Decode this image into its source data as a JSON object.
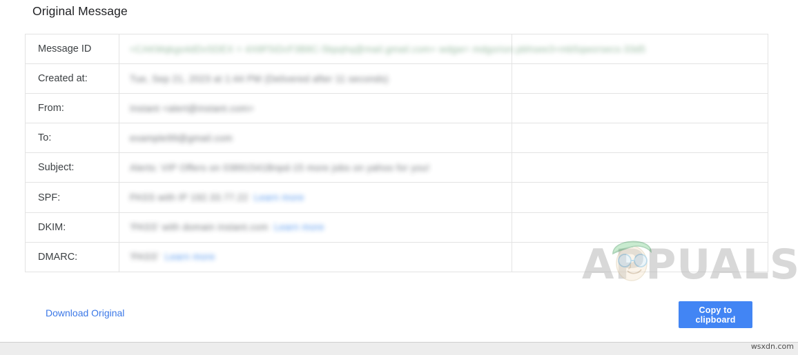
{
  "page": {
    "title": "Original Message",
    "site_credit": "wsxdn.com"
  },
  "table": {
    "rows": [
      {
        "label": "Message ID",
        "value": "<CAKMqkgs4dDvSDEX = 4X8F5iDcF3B8C-5bpqhq@mail.gmail.com+ wdgw= mdgorion.pbhsee3+mb5qworsecs-33d5",
        "value_style": "green",
        "link": "",
        "spill": true
      },
      {
        "label": "Created at:",
        "value": "Tue, Sep 21, 2023 at 1:44 PM (Delivered after 11 seconds)",
        "value_style": "dark",
        "link": "",
        "spill": false
      },
      {
        "label": "From:",
        "value": "Instant <alert@instant.com>",
        "value_style": "dark",
        "link": "",
        "spill": false
      },
      {
        "label": "To:",
        "value": "example99@gmail.com",
        "value_style": "dark",
        "link": "",
        "spill": false
      },
      {
        "label": "Subject:",
        "value": "Alerts: VIP Offers on 03891541Bnpd-15 more jobs on yahoo for you!",
        "value_style": "dark",
        "link": "",
        "spill": false
      },
      {
        "label": "SPF:",
        "value": "PASS with IP 192.33.77.22",
        "value_style": "dark",
        "link": "Learn more",
        "spill": false
      },
      {
        "label": "DKIM:",
        "value": "'PASS' with domain instant.com",
        "value_style": "dark",
        "link": "Learn more",
        "spill": false
      },
      {
        "label": "DMARC:",
        "value": "'PASS'",
        "value_style": "dark",
        "link": "Learn more",
        "spill": false
      }
    ]
  },
  "footer": {
    "download_label": "Download Original",
    "copy_label": "Copy to clipboard"
  },
  "watermark": {
    "text": "APPUALS"
  },
  "colors": {
    "accent_blue": "#4285f4",
    "link_blue": "#3b78e7",
    "border_gray": "#e3e3e3",
    "text_primary": "#202124"
  }
}
